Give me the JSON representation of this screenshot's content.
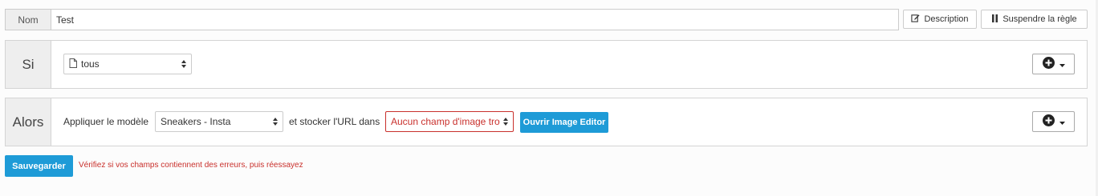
{
  "name_field": {
    "label": "Nom",
    "value": "Test"
  },
  "toolbar": {
    "description_label": "Description",
    "suspend_label": "Suspendre la règle"
  },
  "condition": {
    "label": "Si",
    "selector_value": "tous"
  },
  "action": {
    "label": "Alors",
    "apply_text": "Appliquer le modèle",
    "model_value": "Sneakers - Insta",
    "store_text": "et stocker l'URL dans",
    "field_value": "Aucun champ d'image tro",
    "editor_button": "Ouvrir Image Editor"
  },
  "footer": {
    "save_label": "Sauvegarder",
    "error_message": "Vérifiez si vos champs contiennent des erreurs, puis réessayez"
  },
  "colors": {
    "primary": "#1e9bd7",
    "error": "#c9302c",
    "label_bg": "#eeeeee"
  }
}
